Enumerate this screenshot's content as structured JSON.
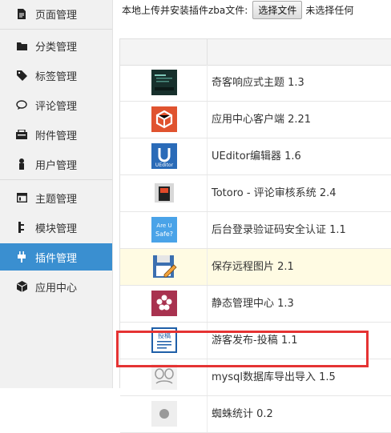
{
  "sidebar": {
    "items": [
      {
        "label": "页面管理",
        "icon": "page-icon"
      },
      {
        "label": "分类管理",
        "icon": "folder-icon"
      },
      {
        "label": "标签管理",
        "icon": "tag-icon"
      },
      {
        "label": "评论管理",
        "icon": "comment-icon"
      },
      {
        "label": "附件管理",
        "icon": "attachment-icon"
      },
      {
        "label": "用户管理",
        "icon": "user-icon"
      },
      {
        "label": "主题管理",
        "icon": "theme-icon"
      },
      {
        "label": "模块管理",
        "icon": "module-icon"
      },
      {
        "label": "插件管理",
        "icon": "plugin-icon",
        "active": true
      },
      {
        "label": "应用中心",
        "icon": "cube-icon"
      }
    ],
    "active_color": "#3a8fd0"
  },
  "upload": {
    "label": "本地上传并安装插件zba文件:",
    "button_label": "选择文件",
    "status": "未选择任何"
  },
  "plugins": {
    "rows": [
      {
        "name": "奇客响应式主题 1.3",
        "icon": "theme-thumbnail-icon"
      },
      {
        "name": "应用中心客户端 2.21",
        "icon": "app-center-icon"
      },
      {
        "name": "UEditor编辑器 1.6",
        "icon": "ueditor-icon",
        "icon_text": "UEditor"
      },
      {
        "name": "Totoro - 评论审核系统 2.4",
        "icon": "totoro-icon"
      },
      {
        "name": "后台登录验证码安全认证 1.1",
        "icon": "are-you-safe-icon",
        "icon_text_1": "Are U",
        "icon_text_2": "Safe?"
      },
      {
        "name": "保存远程图片 2.1",
        "icon": "save-remote-image-icon",
        "highlight": true
      },
      {
        "name": "静态管理中心 1.3",
        "icon": "static-center-icon"
      },
      {
        "name": "游客发布-投稿 1.1",
        "icon": "guest-post-icon",
        "icon_text": "投稿"
      },
      {
        "name": "mysql数据库导出导入 1.5",
        "icon": "mysql-export-icon"
      },
      {
        "name": "蜘蛛统计 0.2",
        "icon": "spider-stats-icon"
      }
    ]
  },
  "annotation": {
    "color": "#e53333"
  }
}
